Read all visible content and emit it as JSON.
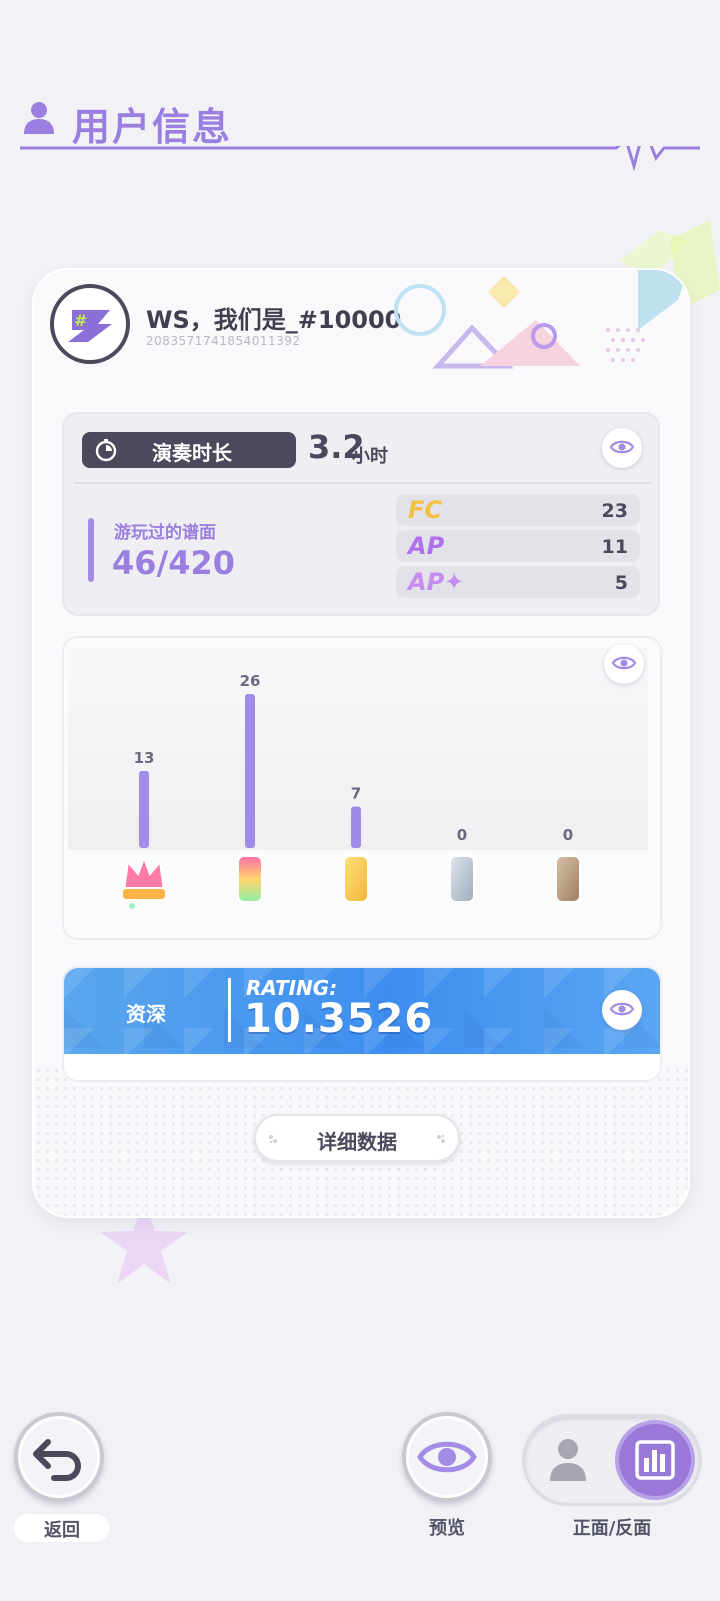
{
  "header": {
    "title": "用户信息"
  },
  "profile": {
    "name": "WS，我们是_#10000",
    "user_id": "2083571741854011392"
  },
  "stats": {
    "playtime_label": "演奏时长",
    "playtime_value": "3.2",
    "playtime_unit": "小时",
    "played_label": "游玩过的谱面",
    "played_value": "46/420",
    "achievements": [
      {
        "tag": "FC",
        "count": "23"
      },
      {
        "tag": "AP",
        "count": "11"
      },
      {
        "tag": "AP✦",
        "count": "5"
      }
    ]
  },
  "chart_data": {
    "type": "bar",
    "categories": [
      "rainbow-crown",
      "rainbow",
      "gold",
      "silver",
      "bronze"
    ],
    "values": [
      13,
      26,
      7,
      0,
      0
    ],
    "ylim": [
      0,
      26
    ],
    "bar_color": "#a08be8"
  },
  "rating": {
    "level": "资深",
    "caption": "RATING:",
    "value": "10.3526"
  },
  "buttons": {
    "details": "详细数据",
    "back": "返回",
    "preview": "预览",
    "flip": "正面/反面"
  },
  "colors": {
    "accent": "#9b7fe0",
    "rating_blue": "#3d8ef0",
    "dark": "#4a4a5c"
  }
}
